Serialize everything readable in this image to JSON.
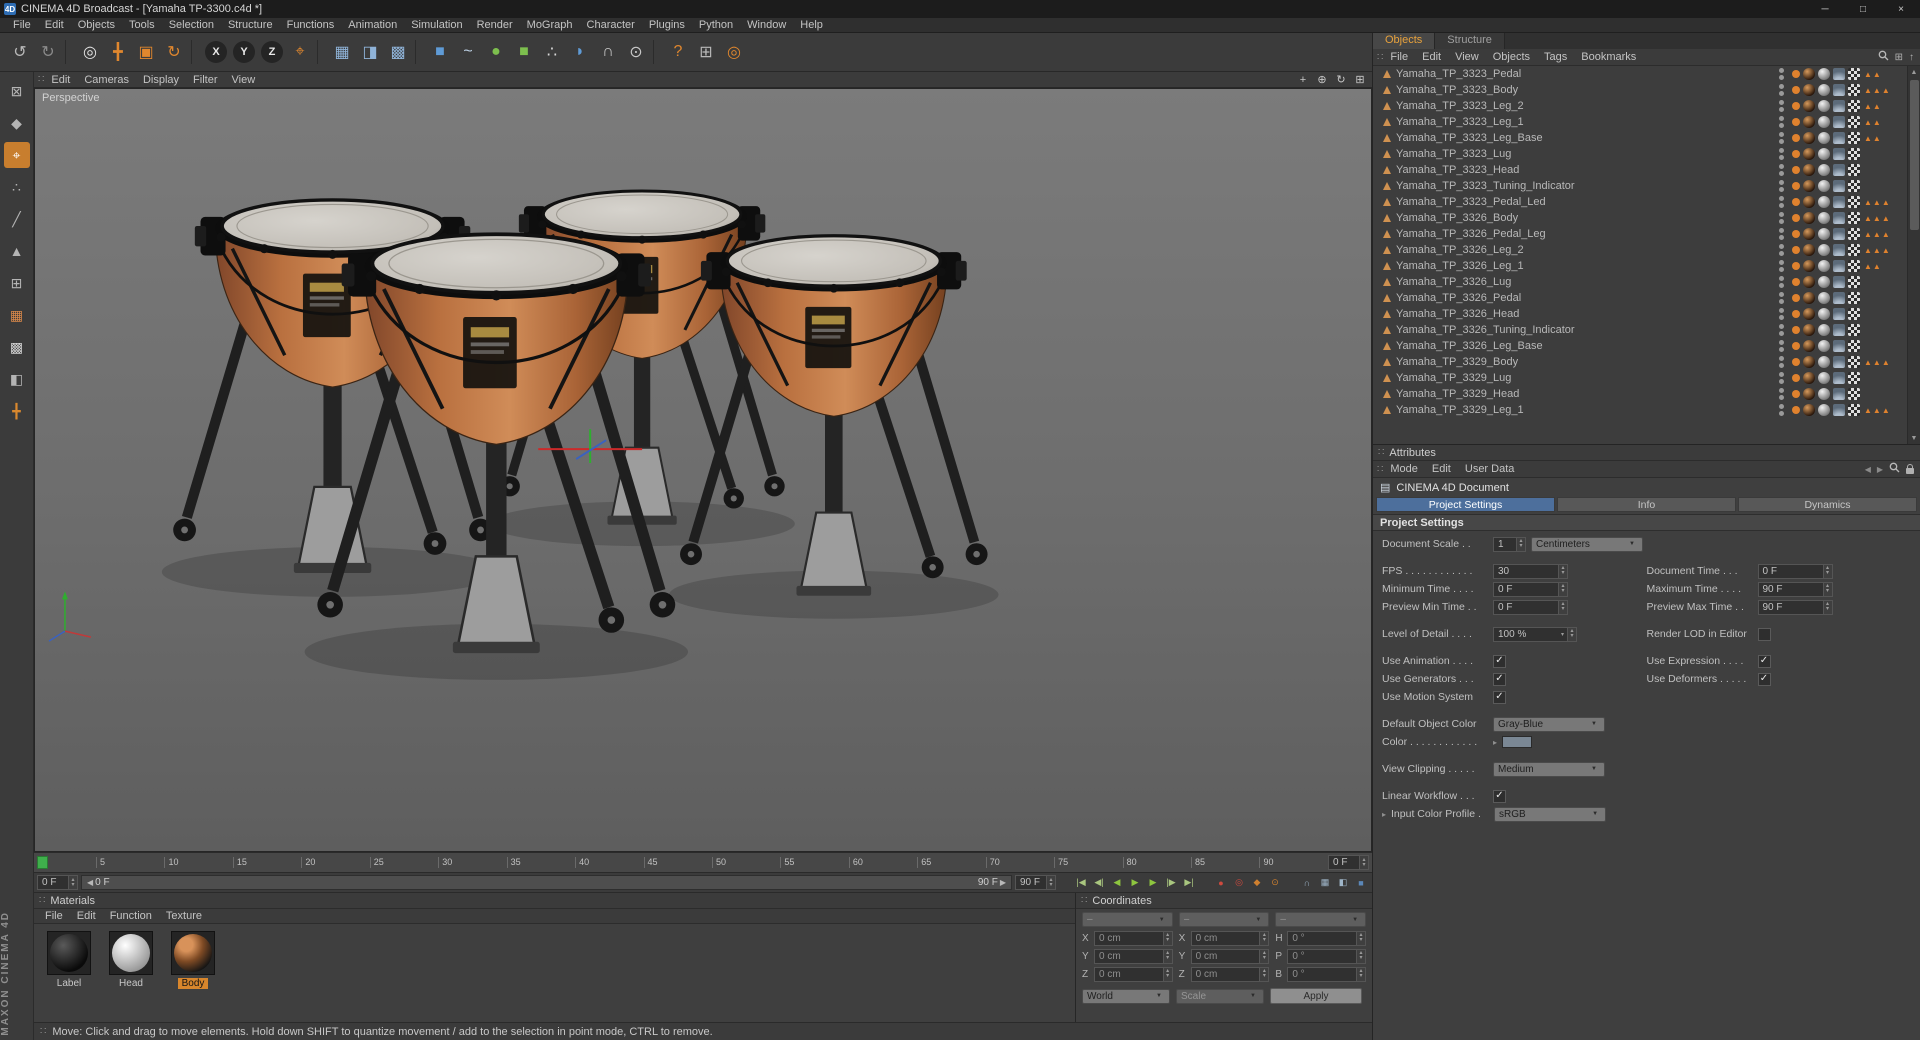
{
  "window": {
    "title": "CINEMA 4D Broadcast - [Yamaha TP-3300.c4d *]",
    "minimize": "─",
    "maximize": "□",
    "close": "×"
  },
  "menubar": [
    "File",
    "Edit",
    "Objects",
    "Tools",
    "Selection",
    "Structure",
    "Functions",
    "Animation",
    "Simulation",
    "Render",
    "MoGraph",
    "Character",
    "Plugins",
    "Python",
    "Window",
    "Help"
  ],
  "toolbar": [
    {
      "name": "undo-icon",
      "glyph": "↺",
      "color": "#b8b8b8"
    },
    {
      "name": "redo-icon",
      "glyph": "↻",
      "color": "#8a8a8a"
    },
    {
      "name": "separator",
      "glyph": "",
      "color": "",
      "cls": "sep"
    },
    {
      "name": "live-selection-icon",
      "glyph": "◎",
      "color": "#e2e2e2"
    },
    {
      "name": "move-tool-icon",
      "glyph": "╋",
      "color": "#e0872e"
    },
    {
      "name": "scale-tool-icon",
      "glyph": "▣",
      "color": "#e0872e"
    },
    {
      "name": "rotate-tool-icon",
      "glyph": "↻",
      "color": "#e0872e"
    },
    {
      "name": "separator",
      "glyph": "",
      "color": "",
      "cls": "sep"
    },
    {
      "name": "lock-x-axis-icon",
      "glyph": "X",
      "color": "#e8e8e8",
      "cls": "circ"
    },
    {
      "name": "lock-y-axis-icon",
      "glyph": "Y",
      "color": "#e8e8e8",
      "cls": "circ"
    },
    {
      "name": "lock-z-axis-icon",
      "glyph": "Z",
      "color": "#e8e8e8",
      "cls": "circ"
    },
    {
      "name": "coordinate-system-icon",
      "glyph": "⌖",
      "color": "#e0872e"
    },
    {
      "name": "separator",
      "glyph": "",
      "color": "",
      "cls": "sep"
    },
    {
      "name": "render-view-icon",
      "glyph": "▦",
      "color": "#8fb3d8"
    },
    {
      "name": "render-region-icon",
      "glyph": "◨",
      "color": "#8fb3d8"
    },
    {
      "name": "render-settings-icon",
      "glyph": "▩",
      "color": "#8fb3d8"
    },
    {
      "name": "separator",
      "glyph": "",
      "color": "",
      "cls": "sep"
    },
    {
      "name": "add-primitive-icon",
      "glyph": "■",
      "color": "#5f9bd6"
    },
    {
      "name": "add-spline-icon",
      "glyph": "~",
      "color": "#bcd0e4"
    },
    {
      "name": "subdivision-surface-icon",
      "glyph": "●",
      "color": "#7dbf4e"
    },
    {
      "name": "generator-icon",
      "glyph": "■",
      "color": "#7dbf4e"
    },
    {
      "name": "particles-icon",
      "glyph": "∴",
      "color": "#d8d8d8"
    },
    {
      "name": "deformer-icon",
      "glyph": "◗",
      "color": "#5f9bd6"
    },
    {
      "name": "snap-icon",
      "glyph": "∩",
      "color": "#c8c8c8"
    },
    {
      "name": "axis-center-icon",
      "glyph": "⊙",
      "color": "#c8c8c8"
    },
    {
      "name": "separator",
      "glyph": "",
      "color": "",
      "cls": "sep"
    },
    {
      "name": "help-icon",
      "glyph": "?",
      "color": "#e0872e"
    },
    {
      "name": "xpresso-icon",
      "glyph": "⊞",
      "color": "#b8b8b8"
    },
    {
      "name": "content-browser-icon",
      "glyph": "◎",
      "color": "#e0872e"
    }
  ],
  "left_palette": [
    {
      "name": "make-editable-icon",
      "glyph": "⊠",
      "color": "#b4b4b4"
    },
    {
      "name": "model-mode-icon",
      "glyph": "◆",
      "color": "#b4b4b4"
    },
    {
      "name": "axis-mode-icon",
      "glyph": "⌖",
      "color": "#ffffff",
      "active": true
    },
    {
      "name": "points-mode-icon",
      "glyph": "∴",
      "color": "#b4b4b4"
    },
    {
      "name": "edges-mode-icon",
      "glyph": "╱",
      "color": "#b4b4b4"
    },
    {
      "name": "polygons-mode-icon",
      "glyph": "▲",
      "color": "#b4b4b4"
    },
    {
      "name": "workplane-icon",
      "glyph": "⊞",
      "color": "#b4b4b4"
    },
    {
      "name": "texture-mode-icon",
      "glyph": "▦",
      "color": "#d9884a"
    },
    {
      "name": "texture-axis-icon",
      "glyph": "▩",
      "color": "#d0d0d0"
    },
    {
      "name": "uv-mode-icon",
      "glyph": "◧",
      "color": "#b4b4b4"
    },
    {
      "name": "enable-axis-icon",
      "glyph": "╋",
      "color": "#d9882e"
    }
  ],
  "viewport": {
    "menu": [
      "Edit",
      "Cameras",
      "Display",
      "Filter",
      "View"
    ],
    "view_label": "Perspective",
    "view_icons": [
      {
        "name": "pan-view-icon",
        "glyph": "+",
        "color": "#c8c8c8"
      },
      {
        "name": "zoom-view-icon",
        "glyph": "⊕",
        "color": "#c8c8c8"
      },
      {
        "name": "rotate-view-icon",
        "glyph": "↻",
        "color": "#c8c8c8"
      },
      {
        "name": "toggle-views-icon",
        "glyph": "⊞",
        "color": "#c8c8c8"
      }
    ]
  },
  "timeline": {
    "ticks": [
      "5",
      "10",
      "15",
      "20",
      "25",
      "30",
      "35",
      "40",
      "45",
      "50",
      "55",
      "60",
      "65",
      "70",
      "75",
      "80",
      "85",
      "90"
    ],
    "field": "0 F"
  },
  "transport": {
    "start": "0 F",
    "range_start": "0 F",
    "range_end": "90 F",
    "end": "90 F",
    "buttons": [
      {
        "name": "go-to-start-button",
        "glyph": "|◀",
        "color": "#a9c67f"
      },
      {
        "name": "previous-key-button",
        "glyph": "◀|",
        "color": "#a9c67f"
      },
      {
        "name": "previous-frame-button",
        "glyph": "◀",
        "color": "#8ec63f"
      },
      {
        "name": "play-button",
        "glyph": "▶",
        "color": "#8ec63f"
      },
      {
        "name": "next-frame-button",
        "glyph": "▶",
        "color": "#8ec63f"
      },
      {
        "name": "next-key-button",
        "glyph": "|▶",
        "color": "#a9c67f"
      },
      {
        "name": "go-to-end-button",
        "glyph": "▶|",
        "color": "#a9c67f"
      },
      {
        "name": "record-keyframe-button",
        "glyph": "●",
        "color": "#cf4a3e",
        "cls": "gap"
      },
      {
        "name": "autokeying-button",
        "glyph": "◎",
        "color": "#cf4a3e"
      },
      {
        "name": "record-position-button",
        "glyph": "◆",
        "color": "#d0802f"
      },
      {
        "name": "keyframe-selection-button",
        "glyph": "⊙",
        "color": "#d0802f"
      },
      {
        "name": "snap-toggle-button",
        "glyph": "∩",
        "color": "#9ab0c4",
        "cls": "gap"
      },
      {
        "name": "quantize-button",
        "glyph": "▦",
        "color": "#9fb6c9"
      },
      {
        "name": "layer-button",
        "glyph": "◧",
        "color": "#9fb6c9"
      },
      {
        "name": "autokey-scope-button",
        "glyph": "■",
        "color": "#5b87b8"
      }
    ]
  },
  "materials_panel": {
    "title": "Materials",
    "menu": [
      "File",
      "Edit",
      "Function",
      "Texture"
    ],
    "items": [
      {
        "name": "Label",
        "cls": "m-label",
        "selected": false
      },
      {
        "name": "Head",
        "cls": "m-head",
        "selected": false
      },
      {
        "name": "Body",
        "cls": "m-body",
        "selected": true
      }
    ]
  },
  "coordinates_panel": {
    "title": "Coordinates",
    "headers": {
      "c1": "–",
      "c2": "–",
      "c3": "–"
    },
    "position": {
      "x": {
        "l": "X",
        "v": "0 cm"
      },
      "y": {
        "l": "Y",
        "v": "0 cm"
      },
      "z": {
        "l": "Z",
        "v": "0 cm"
      }
    },
    "size": {
      "x": {
        "l": "X",
        "v": "0 cm"
      },
      "y": {
        "l": "Y",
        "v": "0 cm"
      },
      "z": {
        "l": "Z",
        "v": "0 cm"
      }
    },
    "rotation": {
      "h": {
        "l": "H",
        "v": "0 °"
      },
      "p": {
        "l": "P",
        "v": "0 °"
      },
      "b": {
        "l": "B",
        "v": "0 °"
      }
    },
    "world_select": "World",
    "scale_select": "Scale",
    "apply_label": "Apply"
  },
  "objects_panel": {
    "tabs": [
      {
        "label": "Objects",
        "name": "tab-objects",
        "active": true
      },
      {
        "label": "Structure",
        "name": "tab-structure",
        "active": false
      }
    ],
    "menu": [
      "File",
      "Edit",
      "View",
      "Objects",
      "Tags",
      "Bookmarks"
    ],
    "items": [
      {
        "name": "Yamaha_TP_3323_Pedal",
        "tags": "▲▲"
      },
      {
        "name": "Yamaha_TP_3323_Body",
        "tags": "▲▲▲"
      },
      {
        "name": "Yamaha_TP_3323_Leg_2",
        "tags": "▲▲"
      },
      {
        "name": "Yamaha_TP_3323_Leg_1",
        "tags": "▲▲"
      },
      {
        "name": "Yamaha_TP_3323_Leg_Base",
        "tags": "▲▲"
      },
      {
        "name": "Yamaha_TP_3323_Lug",
        "tags": ""
      },
      {
        "name": "Yamaha_TP_3323_Head",
        "tags": ""
      },
      {
        "name": "Yamaha_TP_3323_Tuning_Indicator",
        "tags": ""
      },
      {
        "name": "Yamaha_TP_3323_Pedal_Led",
        "tags": "▲▲▲"
      },
      {
        "name": "Yamaha_TP_3326_Body",
        "tags": "▲▲▲"
      },
      {
        "name": "Yamaha_TP_3326_Pedal_Leg",
        "tags": "▲▲▲"
      },
      {
        "name": "Yamaha_TP_3326_Leg_2",
        "tags": "▲▲▲"
      },
      {
        "name": "Yamaha_TP_3326_Leg_1",
        "tags": "▲▲"
      },
      {
        "name": "Yamaha_TP_3326_Lug",
        "tags": ""
      },
      {
        "name": "Yamaha_TP_3326_Pedal",
        "tags": ""
      },
      {
        "name": "Yamaha_TP_3326_Head",
        "tags": ""
      },
      {
        "name": "Yamaha_TP_3326_Tuning_Indicator",
        "tags": ""
      },
      {
        "name": "Yamaha_TP_3326_Leg_Base",
        "tags": ""
      },
      {
        "name": "Yamaha_TP_3329_Body",
        "tags": "▲▲▲"
      },
      {
        "name": "Yamaha_TP_3329_Lug",
        "tags": ""
      },
      {
        "name": "Yamaha_TP_3329_Head",
        "tags": ""
      },
      {
        "name": "Yamaha_TP_3329_Leg_1",
        "tags": "▲▲▲"
      }
    ]
  },
  "attributes_panel": {
    "title": "Attributes",
    "menu": [
      "Mode",
      "Edit",
      "User Data"
    ],
    "document": "CINEMA 4D Document",
    "tabs": [
      {
        "label": "Project Settings",
        "name": "tab-project-settings",
        "active": true
      },
      {
        "label": "Info",
        "name": "tab-info",
        "active": false
      },
      {
        "label": "Dynamics",
        "name": "tab-dynamics",
        "active": false
      }
    ],
    "section": "Project Settings",
    "fields": {
      "document_scale": {
        "label": "Document Scale . .",
        "value": "1",
        "unit": "Centimeters"
      },
      "fps": {
        "label": "FPS . . . . . . . . . . . .",
        "value": "30"
      },
      "document_time": {
        "label": "Document Time . . .",
        "value": "0 F"
      },
      "minimum_time": {
        "label": "Minimum Time . . . .",
        "value": "0 F"
      },
      "maximum_time": {
        "label": "Maximum Time . . . .",
        "value": "90 F"
      },
      "preview_min": {
        "label": "Preview Min Time . .",
        "value": "0 F"
      },
      "preview_max": {
        "label": "Preview Max Time . .",
        "value": "90 F"
      },
      "lod": {
        "label": "Level of Detail . . . .",
        "value": "100 %"
      },
      "render_lod": {
        "label": "Render LOD in Editor",
        "check": ""
      },
      "use_animation": {
        "label": "Use Animation . . . .",
        "check": "✓"
      },
      "use_expression": {
        "label": "Use Expression . . . .",
        "check": "✓"
      },
      "use_generators": {
        "label": "Use Generators . . .",
        "check": "✓"
      },
      "use_deformers": {
        "label": "Use Deformers . . . . .",
        "check": "✓"
      },
      "use_motion": {
        "label": "Use Motion System",
        "check": "✓"
      },
      "default_color": {
        "label": "Default Object Color",
        "value": "Gray-Blue"
      },
      "color": {
        "label": "Color . . . . . . . . . . . .",
        "swatch": "#7a8794"
      },
      "view_clipping": {
        "label": "View Clipping . . . . .",
        "value": "Medium"
      },
      "linear_workflow": {
        "label": "Linear Workflow . . .",
        "check": "✓"
      },
      "input_profile": {
        "label": "Input Color Profile .",
        "value": "sRGB"
      }
    }
  },
  "status_bar": "Move: Click and drag to move elements. Hold down SHIFT to quantize movement / add to the selection in point mode, CTRL to remove.",
  "brand": "MAXON CINEMA 4D",
  "colors": {
    "accent_orange": "#d9882e",
    "selection_blue": "#4d6f9c",
    "play_green": "#8ec63f",
    "record_red": "#cf4a3e",
    "copper": "#c08050"
  }
}
